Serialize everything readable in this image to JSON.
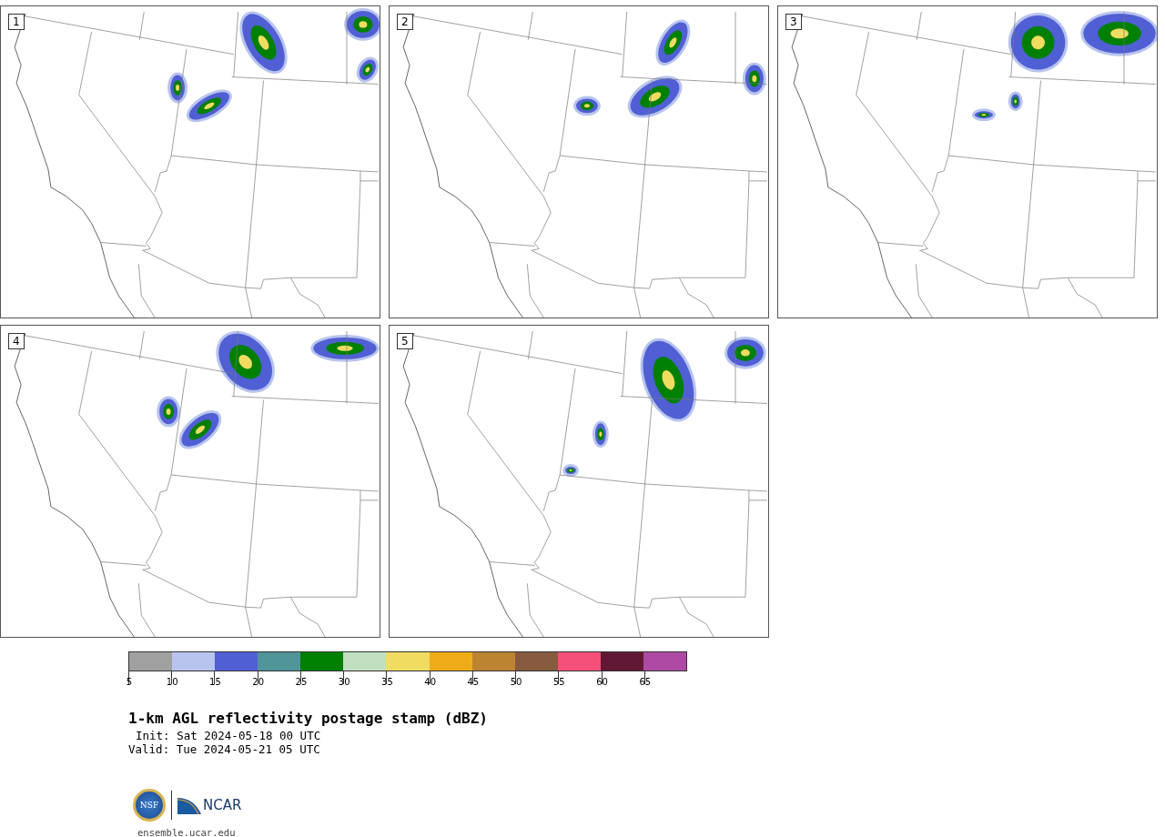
{
  "panels": [
    {
      "number": "1"
    },
    {
      "number": "2"
    },
    {
      "number": "3"
    },
    {
      "number": "4"
    },
    {
      "number": "5"
    }
  ],
  "colorbar": {
    "bins": [
      {
        "label": "5",
        "color": "#a0a0a0"
      },
      {
        "label": "10",
        "color": "#b8c4ee"
      },
      {
        "label": "15",
        "color": "#505fd4"
      },
      {
        "label": "20",
        "color": "#509598"
      },
      {
        "label": "25",
        "color": "#008000"
      },
      {
        "label": "30",
        "color": "#c0dfc0"
      },
      {
        "label": "35",
        "color": "#f0dc60"
      },
      {
        "label": "40",
        "color": "#f0ac18"
      },
      {
        "label": "45",
        "color": "#bc8430"
      },
      {
        "label": "50",
        "color": "#885a40"
      },
      {
        "label": "55",
        "color": "#f4507a"
      },
      {
        "label": "60",
        "color": "#601834"
      },
      {
        "label": "65",
        "color": "#ae4aa4"
      }
    ]
  },
  "title": "1-km AGL reflectivity postage stamp (dBZ)",
  "init": "Init: Sat 2024-05-18 00 UTC",
  "valid": "Valid: Tue 2024-05-21 05 UTC",
  "logo": {
    "left": "NSF",
    "right": "NCAR"
  },
  "footer": "ensemble.ucar.edu"
}
